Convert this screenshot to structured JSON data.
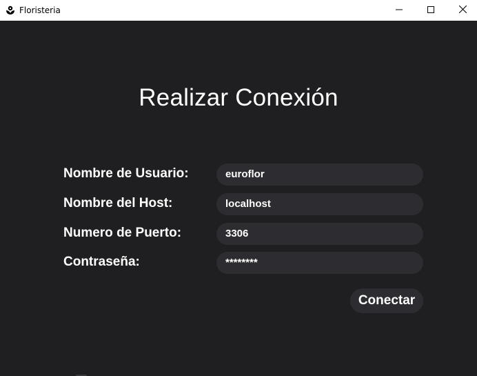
{
  "window": {
    "title": "Floristeria",
    "app_icon": "flower-icon",
    "controls": [
      "minimize-icon",
      "maximize-icon",
      "close-icon"
    ]
  },
  "form": {
    "heading": "Realizar Conexión",
    "fields": [
      {
        "label": "Nombre de Usuario:",
        "value": "euroflor"
      },
      {
        "label": "Nombre del Host:",
        "value": "localhost"
      },
      {
        "label": "Numero de Puerto:",
        "value": "3306"
      },
      {
        "label": "Contraseña:",
        "value": "********"
      }
    ],
    "submit_label": "Conectar"
  },
  "colors": {
    "background": "#1f1f21",
    "field_background": "#2d2d31",
    "text": "#ffffff",
    "titlebar": "#ffffff"
  }
}
